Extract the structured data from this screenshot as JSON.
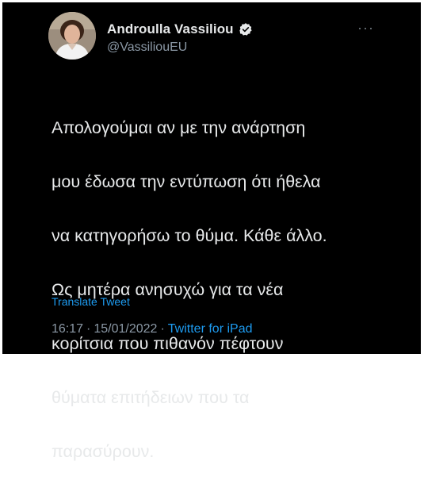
{
  "tweet": {
    "author": {
      "name": "Androulla Vassiliou",
      "handle": "@VassiliouEU",
      "verified_icon": "verified-badge-icon",
      "avatar_icon": "profile-photo"
    },
    "more_label": "···",
    "lines": [
      "Απολογούμαι αν με την ανάρτηση",
      "μου έδωσα την εντύπωση ότι ήθελα",
      "να κατηγορήσω το θύμα. Κάθε άλλο.",
      "Ως μητέρα ανησυχώ για τα νέα",
      "κορίτσια που πιθανόν πέφτουν",
      "θύματα επιτήδειων που τα",
      "παρασύρουν."
    ],
    "translate_label": "Translate Tweet",
    "time": "16:17",
    "separator": "·",
    "date": "15/01/2022",
    "source": "Twitter for iPad",
    "colors": {
      "background": "#000000",
      "text": "#e7e9ea",
      "secondary": "#8b98a5",
      "link": "#1d9bf0"
    }
  }
}
